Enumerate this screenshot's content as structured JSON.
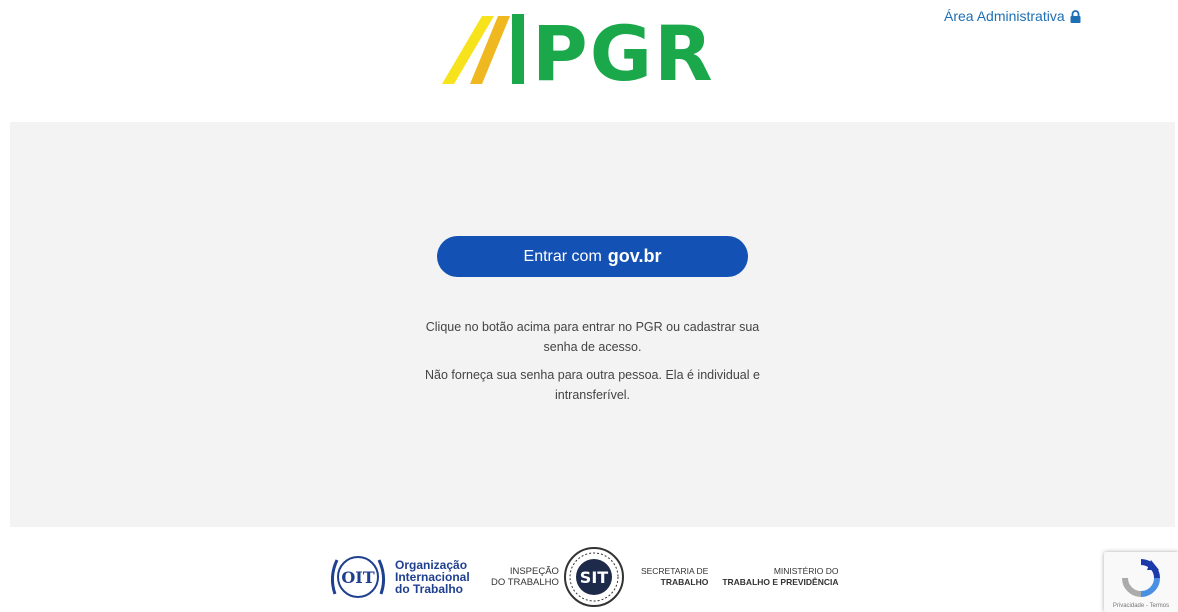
{
  "header": {
    "logo_text": "PGR",
    "admin_link": "Área Administrativa",
    "admin_icon": "lock-icon"
  },
  "main": {
    "login_button": {
      "prefix": "Entrar com",
      "brand": "gov.br"
    },
    "info_line_1": "Clique no botão acima para entrar no PGR ou cadastrar sua senha de acesso.",
    "info_line_2": "Não forneça sua senha para outra pessoa. Ela é individual e intransferível."
  },
  "footer": {
    "oit_mark": "OIT",
    "oit_lines": [
      "Organização",
      "Internacional",
      "do Trabalho"
    ],
    "inspecao_lines": [
      "INSPEÇÃO",
      "DO TRABALHO"
    ],
    "sit_mark": "SIT",
    "secretaria_lines": [
      "SECRETARIA DE",
      "TRABALHO"
    ],
    "ministerio_lines": [
      "MINISTÉRIO DO",
      "TRABALHO E PREVIDÊNCIA"
    ]
  },
  "recaptcha": {
    "links": "Privacidade - Termos"
  },
  "colors": {
    "brand_green": "#1aa84b",
    "brand_yellow": "#f2d321",
    "govbr_blue": "#1351b4",
    "admin_link": "#1f6fb5",
    "panel_bg": "#f3f3f3"
  }
}
